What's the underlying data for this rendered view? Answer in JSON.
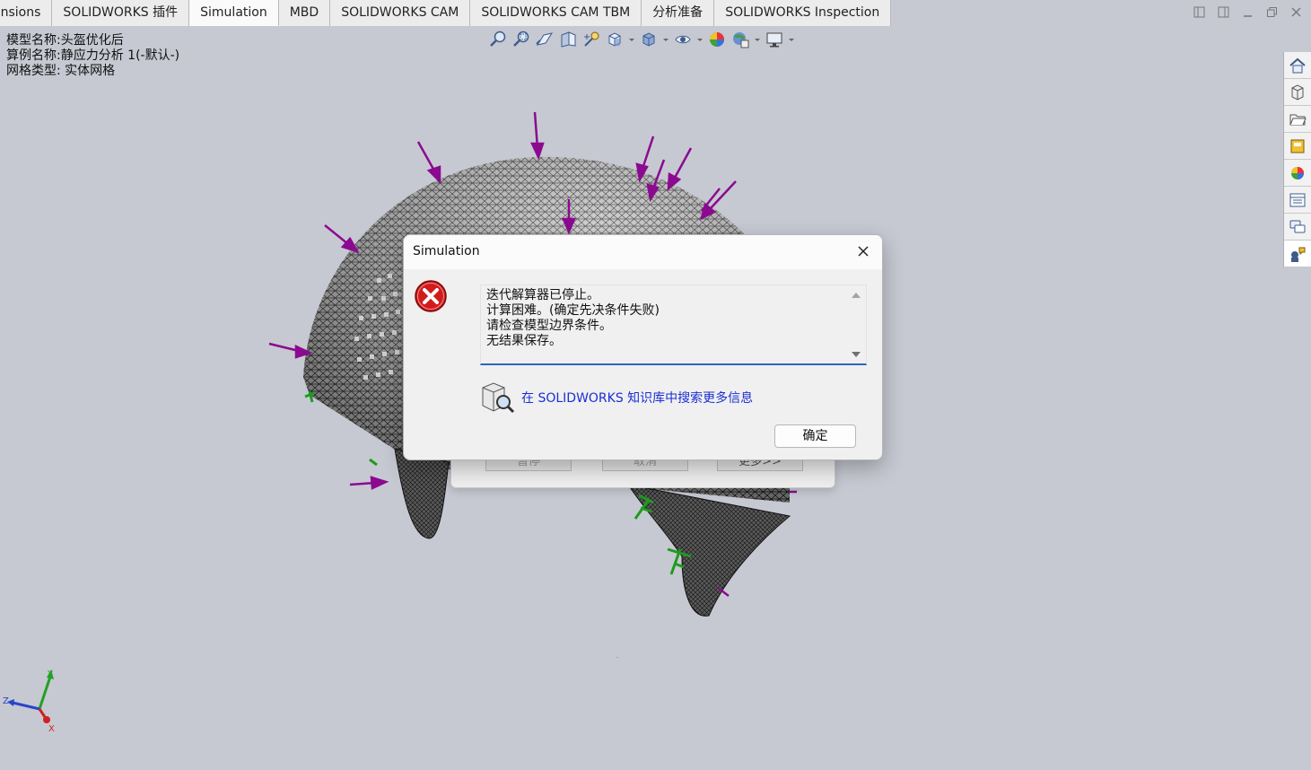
{
  "tabs": [
    {
      "label": "ensions",
      "active": false
    },
    {
      "label": "SOLIDWORKS 插件",
      "active": false
    },
    {
      "label": "Simulation",
      "active": true
    },
    {
      "label": "MBD",
      "active": false
    },
    {
      "label": "SOLIDWORKS CAM",
      "active": false
    },
    {
      "label": "SOLIDWORKS CAM TBM",
      "active": false
    },
    {
      "label": "分析准备",
      "active": false
    },
    {
      "label": "SOLIDWORKS Inspection",
      "active": false
    }
  ],
  "model_info": {
    "model_name": "模型名称:头盔优化后",
    "study_name": "算例名称:静应力分析 1(-默认-)",
    "mesh_type": "网格类型: 实体网格"
  },
  "hud_icons": [
    "zoom-to-fit-icon",
    "zoom-to-area-icon",
    "previous-view-icon",
    "section-view-icon",
    "dynamic-annotation-icon",
    "view-orientation-icon",
    "display-style-icon",
    "hide-show-icon",
    "edit-appearance-icon",
    "apply-scene-icon",
    "view-settings-icon"
  ],
  "taskpane_icons": [
    "home-icon",
    "3d-content-icon",
    "file-explorer-icon",
    "view-palette-icon",
    "appearances-icon",
    "custom-properties-icon",
    "forum-icon",
    "simulation-advisor-icon"
  ],
  "progress_dialog": {
    "pause_label": "暂停",
    "cancel_label": "取消",
    "more_label": "更多>>"
  },
  "error_dialog": {
    "title": "Simulation",
    "messages": [
      "迭代解算器已停止。",
      "计算困难。(确定先决条件失败)",
      "请检查模型边界条件。",
      "无结果保存。"
    ],
    "kb_link": "在 SOLIDWORKS 知识库中搜索更多信息",
    "ok_label": "确定"
  },
  "triad": {
    "x_label": "X",
    "y_label": "Y",
    "z_label": "Z"
  },
  "colors": {
    "viewport_bg": "#c6c9d2",
    "load_arrow": "#8b0a8f",
    "fixture": "#1f9b1f",
    "error_red": "#d11b1b",
    "link_blue": "#1b2fd3"
  }
}
